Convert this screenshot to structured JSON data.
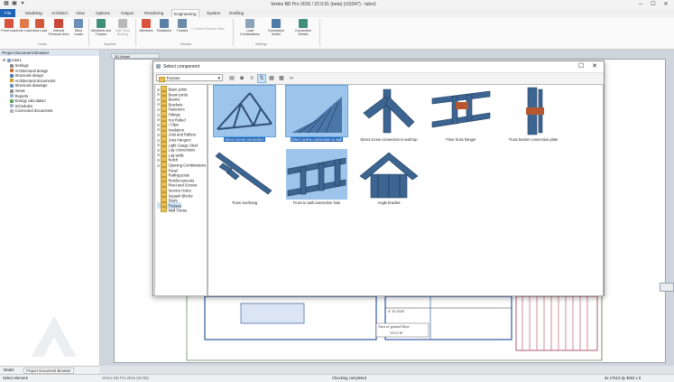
{
  "window": {
    "title": "Vertex BD Pro 2016 / 22.0.01 (beta) (r15247) - tutor1"
  },
  "ribbon": {
    "tabs": [
      "File",
      "Modeling",
      "Architect",
      "View",
      "Options",
      "Output",
      "Rendering",
      "Engineering",
      "System",
      "Drafting"
    ],
    "active_tab": "Engineering",
    "loads": [
      "Point Load",
      "Line Load",
      "Area Load",
      "Internal Pressure Area",
      "Wind Loads"
    ],
    "symbols": [
      "Members and Trusses",
      "Wall Wind Bracing"
    ],
    "results": [
      "Members",
      "Reactions",
      "Trusses"
    ],
    "show_results_view": "Show Results View",
    "settings": [
      "Load Combinations",
      "Connection Model",
      "Connection Details"
    ],
    "groups": [
      "Loads",
      "Symbols",
      "Results",
      "Settings"
    ]
  },
  "left_panel": {
    "header": "Project Document Browser",
    "root": "tutor1",
    "items": [
      "Settings",
      "Architectural design",
      "Structural design",
      "Architectural documents",
      "Structural drawings",
      "Views",
      "Reports",
      "Energy calculation",
      "Schedules",
      "Connected documents"
    ],
    "bottom_tabs": [
      "Model",
      "Project Document Browser"
    ]
  },
  "dialog": {
    "title": "Select component",
    "dropdown_value": "Trusses",
    "tree": [
      "Basic joints",
      "Beam joints",
      "Beams",
      "Brackets",
      "Fasteners",
      "Fittings",
      "Hot Rolled",
      "I Clips",
      "Insulation",
      "Joist and Rafters",
      "Joist Hangers",
      "Light Gauge Steel",
      "Log connections",
      "Log walls",
      "Notch",
      "Opening Combinations",
      "Panel",
      "Railing posts",
      "Reinforcements",
      "Rivet and Screws",
      "Service Holes",
      "Squash Blocks",
      "Stairs",
      "Trusses",
      "Wall Frame"
    ],
    "tree_expandable": [
      0,
      1,
      2,
      3,
      4,
      5,
      6,
      7,
      8,
      9,
      10,
      11,
      12,
      13,
      14,
      15
    ],
    "selected_folder": "Trusses",
    "components": [
      "Direct screw connection",
      "Direct screw connection to wall",
      "Direct screw connection to wall top",
      "Floor truss hanger",
      "Truss backer connection plate",
      "Truss overhang",
      "Truss to wall connection hole",
      "Angle bracket"
    ],
    "selected_components": [
      0,
      1
    ]
  },
  "drawing": {
    "area_note": "Area of ground floor",
    "area_value": "131.6 ft²",
    "dimension_label": "4' 10 3/16\"",
    "tab_label": "3D Model"
  },
  "status": {
    "left": "Select element",
    "mid_left": "Vertex BD Pro 2016 (64 Bit)",
    "center": "Checking completed",
    "coords": "dx 17613   dy 3563   x 0"
  },
  "colors": {
    "file_tab": "#1e63b8",
    "selection": "#1e63b8",
    "selection_light": "#cde3f7",
    "folder": "#e7c05b"
  }
}
